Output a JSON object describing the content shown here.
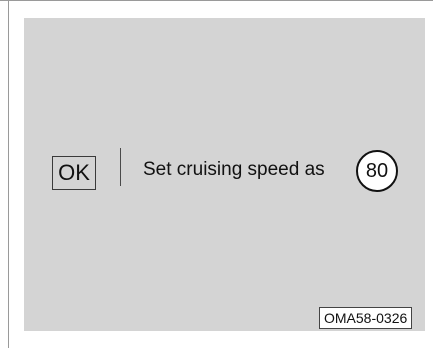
{
  "display": {
    "ok_label": "OK",
    "message": "Set cruising speed as",
    "speed_value": "80"
  },
  "figure_code": "OMA58-0326",
  "colors": {
    "panel_background": "#d4d4d4",
    "text": "#111111",
    "sign_background": "#ffffff"
  }
}
